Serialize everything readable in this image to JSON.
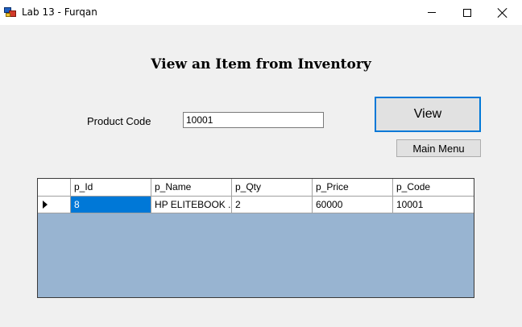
{
  "window": {
    "title": "Lab 13 - Furqan"
  },
  "form": {
    "heading": "View an Item from Inventory",
    "product_code_label": "Product Code",
    "product_code_value": "10001",
    "view_button": "View",
    "main_menu_button": "Main Menu"
  },
  "grid": {
    "columns": [
      "p_Id",
      "p_Name",
      "p_Qty",
      "p_Price",
      "p_Code"
    ],
    "rows": [
      [
        "8",
        "HP ELITEBOOK ...",
        "2",
        "60000",
        "10001"
      ]
    ],
    "selected_cell": "p_Id"
  },
  "colors": {
    "accent": "#0078d7",
    "grid_background": "#98b4d1",
    "form_background": "#f0f0f0"
  }
}
